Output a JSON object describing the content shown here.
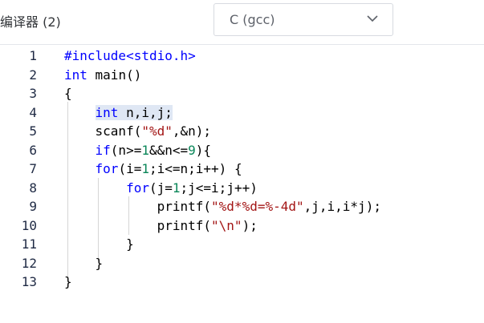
{
  "header": {
    "compiler_label": "编译器 (2)",
    "compiler_select_value": "C (gcc)"
  },
  "editor": {
    "line_numbers": [
      "1",
      "2",
      "3",
      "4",
      "5",
      "6",
      "7",
      "8",
      "9",
      "10",
      "11",
      "12",
      "13"
    ],
    "code": [
      "#include<stdio.h>",
      "int main()",
      "{",
      "    int n,i,j;",
      "    scanf(\"%d\",&n);",
      "    if(n>=1&&n<=9){",
      "    for(i=1;i<=n;i++) {",
      "        for(j=1;j<=i;j++)",
      "            printf(\"%d*%d=%-4d\",j,i,i*j);",
      "            printf(\"\\n\");",
      "        }",
      "    }",
      "}"
    ],
    "selected_text": "int n,i,j;"
  },
  "colors": {
    "keyword": "#0000ff",
    "string": "#a31515",
    "number": "#098658",
    "selection": "#dfe7f4",
    "line_number": "#1f2a44"
  }
}
